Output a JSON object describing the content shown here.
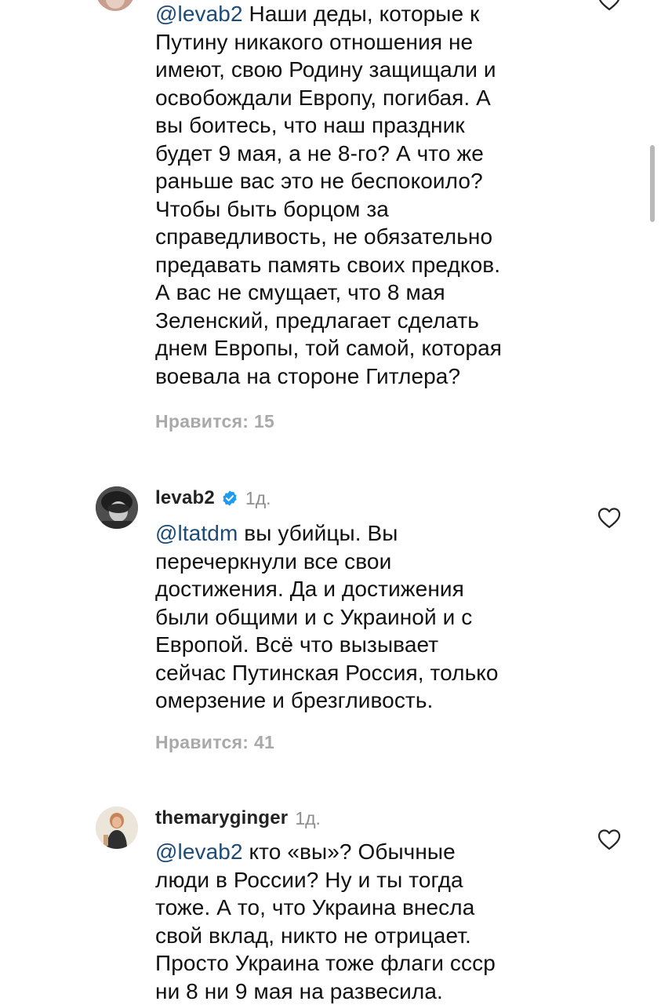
{
  "comments": [
    {
      "mention": "@levab2",
      "body": " Наши деды, которые к\nПутину никакого отношения не\nимеют, свою Родину защищали и\nосвобождали Европу, погибая. А\nвы боитесь, что наш праздник\nбудет 9 мая, а не 8-го? А что же\nраньше вас это не беспокоило?\nЧтобы быть борцом за\nсправедливость, не обязательно\nпредавать память своих предков.\nА вас не смущает, что 8 мая\nЗеленский, предлагает сделать\nднем Европы, той самой, которая\nвоевала на стороне Гитлера?",
      "likes": "Нравится: 15"
    },
    {
      "username": "levab2",
      "time": "1д.",
      "mention": "@ltatdm",
      "body": " вы убийцы. Вы\nперечеркнули все свои\nдостижения. Да и достижения\nбыли общими и с Украиной и с\nЕвропой. Всё что вызывает\nсейчас Путинская Россия, только\nомерзение и брезгливость.",
      "likes": "Нравится: 41"
    },
    {
      "username": "themaryginger",
      "time": "1д.",
      "mention": "@levab2",
      "body": " кто «вы»? Обычные\nлюди в России? Ну и ты тогда\nтоже. А то, что Украина внесла\nсвой вклад, никто не отрицает.\nПросто Украина тоже флаги ссср\nни 8 ни 9 мая на развесила."
    }
  ],
  "icons": {
    "like": "heart-outline-icon",
    "verified": "verified-badge-icon"
  },
  "colors": {
    "mention": "#1c4b7a",
    "likes_text": "#a9a9a9",
    "verified": "#1d9bf0"
  }
}
